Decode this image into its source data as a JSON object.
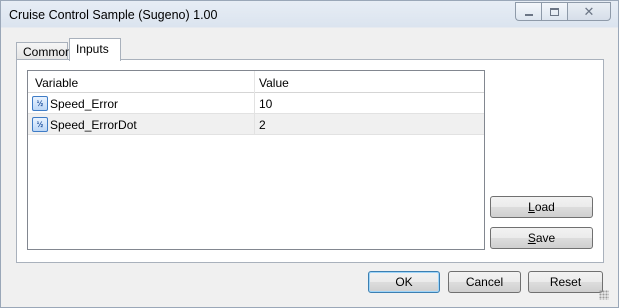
{
  "window": {
    "title": "Cruise Control Sample (Sugeno) 1.00"
  },
  "tabs": [
    {
      "label": "Common",
      "active": false
    },
    {
      "label": "Inputs",
      "active": true
    }
  ],
  "grid": {
    "columns": [
      "Variable",
      "Value"
    ],
    "rows": [
      {
        "icon": "½",
        "name": "Speed_Error",
        "value": "10"
      },
      {
        "icon": "½",
        "name": "Speed_ErrorDot",
        "value": "2"
      }
    ]
  },
  "side_buttons": {
    "load_u": "L",
    "load_rest": "oad",
    "save_u": "S",
    "save_rest": "ave"
  },
  "footer": {
    "ok": "OK",
    "cancel": "Cancel",
    "reset": "Reset"
  },
  "colors": {
    "default_button_border": "#3c7fb1",
    "icon_blue": "#3f7cc6"
  }
}
